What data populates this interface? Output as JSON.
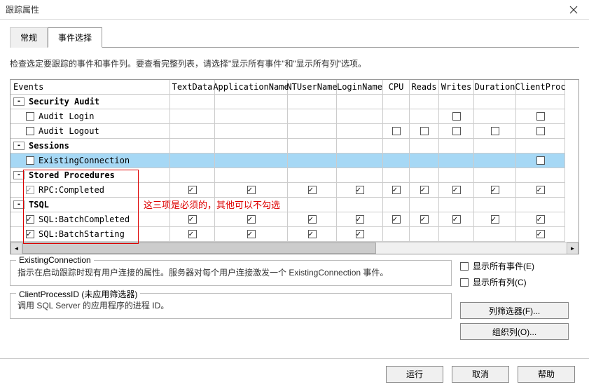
{
  "window": {
    "title": "跟踪属性"
  },
  "tabs": [
    {
      "label": "常规",
      "active": false
    },
    {
      "label": "事件选择",
      "active": true
    }
  ],
  "instruction": "检查选定要跟踪的事件和事件列。要查看完整列表，请选择\"显示所有事件\"和\"显示所有列\"选项。",
  "columns": [
    "Events",
    "TextData",
    "ApplicationName",
    "NTUserName",
    "LoginName",
    "CPU",
    "Reads",
    "Writes",
    "Duration",
    "ClientProc"
  ],
  "rows": [
    {
      "kind": "cat",
      "label": "Security Audit",
      "exp": "-"
    },
    {
      "kind": "item",
      "label": "Audit Login",
      "cb": true,
      "checked": false,
      "cells": [
        "u",
        "",
        "",
        "",
        "",
        "",
        "",
        "u",
        "",
        "u"
      ]
    },
    {
      "kind": "item",
      "label": "Audit Logout",
      "cb": true,
      "checked": false,
      "cells": [
        "",
        "",
        "",
        "",
        "",
        "u",
        "u",
        "u",
        "u",
        "u"
      ]
    },
    {
      "kind": "cat",
      "label": "Sessions",
      "exp": "-"
    },
    {
      "kind": "item",
      "label": "ExistingConnection",
      "cb": true,
      "checked": false,
      "sel": true,
      "cells": [
        "u",
        "",
        "",
        "",
        "",
        "",
        "",
        "",
        "",
        "u"
      ]
    },
    {
      "kind": "cat",
      "label": "Stored Procedures",
      "exp": "-"
    },
    {
      "kind": "item",
      "label": "RPC:Completed",
      "cb": true,
      "checked": true,
      "dim": true,
      "cells": [
        "",
        "c",
        "c",
        "c",
        "c",
        "c",
        "c",
        "c",
        "c",
        "c"
      ]
    },
    {
      "kind": "cat",
      "label": "TSQL",
      "exp": "-"
    },
    {
      "kind": "item",
      "label": "SQL:BatchCompleted",
      "cb": true,
      "checked": true,
      "cells": [
        "",
        "c",
        "c",
        "c",
        "c",
        "c",
        "c",
        "c",
        "c",
        "c"
      ]
    },
    {
      "kind": "item",
      "label": "SQL:BatchStarting",
      "cb": true,
      "checked": true,
      "cells": [
        "",
        "c",
        "c",
        "c",
        "c",
        "",
        "",
        "",
        "",
        "c"
      ]
    }
  ],
  "annotation": "这三项是必须的，其他可以不勾选",
  "fieldset1": {
    "legend": "ExistingConnection",
    "body": "指示在启动跟踪时现有用户连接的属性。服务器对每个用户连接激发一个 ExistingConnection 事件。"
  },
  "fieldset2": {
    "legend": "ClientProcessID (未应用筛选器)",
    "body": "调用 SQL Server 的应用程序的进程 ID。"
  },
  "showAllEvents": "显示所有事件(E)",
  "showAllCols": "显示所有列(C)",
  "colFilterBtn": "列筛选器(F)...",
  "orgColsBtn": "组织列(O)...",
  "runBtn": "运行",
  "cancelBtn": "取消",
  "helpBtn": "帮助"
}
